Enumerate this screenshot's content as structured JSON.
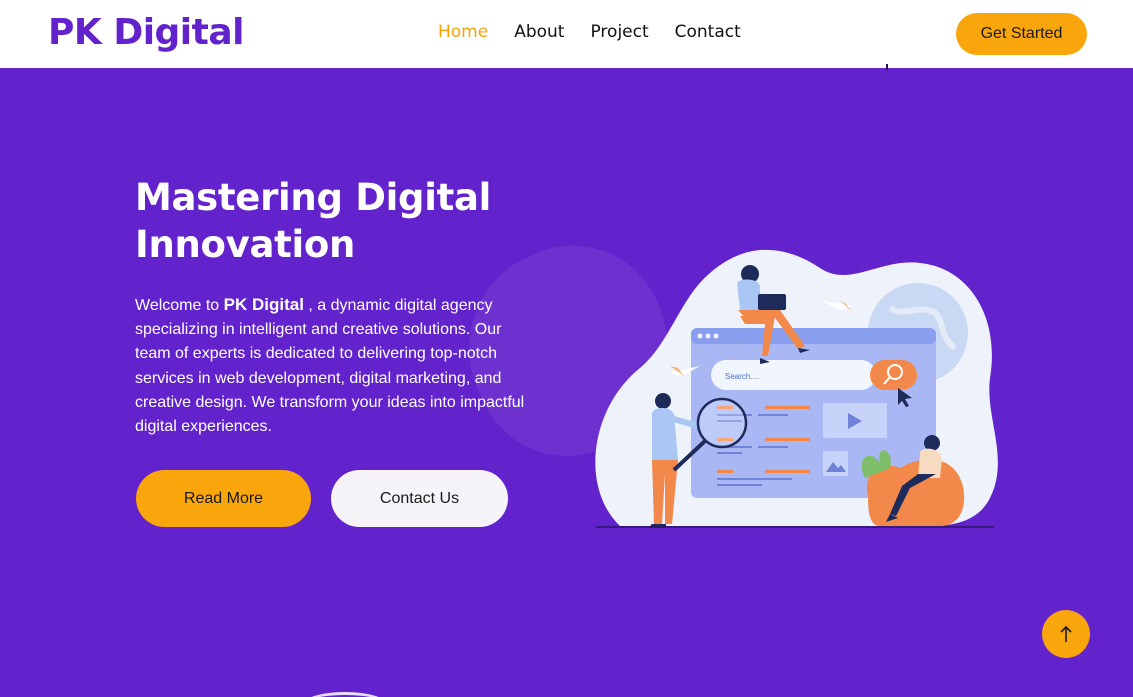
{
  "brand": {
    "name": "PK Digital",
    "color": "#6222cc",
    "accent": "#f9a50c"
  },
  "nav": {
    "items": [
      {
        "label": "Home",
        "active": true
      },
      {
        "label": "About",
        "active": false
      },
      {
        "label": "Project",
        "active": false
      },
      {
        "label": "Contact",
        "active": false
      }
    ],
    "cta_label": "Get Started"
  },
  "hero": {
    "title_line1": "Mastering Digital",
    "title_line2": "Innovation",
    "desc_prefix": "Welcome to",
    "desc_brand": "PK Digital",
    "desc_body": ", a dynamic digital agency specializing in intelligent and creative solutions. Our team of experts is dedicated to delivering top-notch services in web development, digital marketing, and creative design. We transform your ideas into impactful digital experiences.",
    "primary_button": "Read More",
    "secondary_button": "Contact Us"
  },
  "illustration": {
    "search_placeholder": "Search...."
  },
  "scroll_top": {
    "icon": "arrow-up-icon"
  }
}
